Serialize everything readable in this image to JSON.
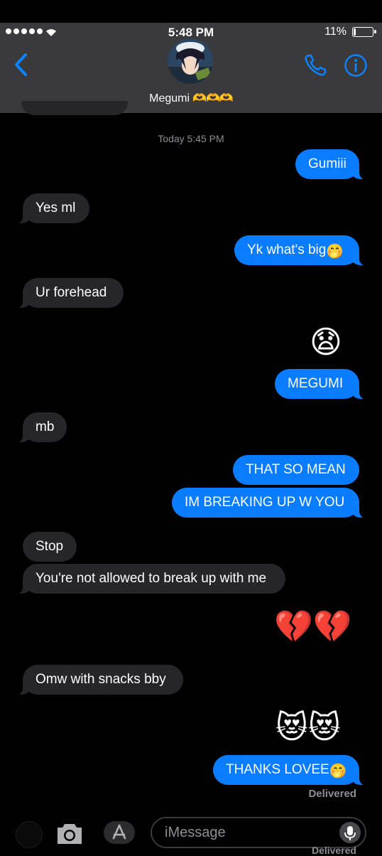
{
  "status_bar": {
    "time": "5:48 PM",
    "battery_percent": "11%",
    "battery_level": 0.11
  },
  "header": {
    "contact_name": "Megumi",
    "contact_emoji": "🫶🫶🫶",
    "back_icon": "chevron-left-icon",
    "call_icon": "phone-icon",
    "info_icon": "info-icon"
  },
  "conversation": {
    "timestamp": "Today 5:45 PM",
    "messages": {
      "m1": "Gumiii",
      "m2": "Yes ml",
      "m3": "Yk what's big",
      "m3_emoji": "🤭",
      "m4": "Ur forehead",
      "m5": "😧",
      "m6": "MEGUMI",
      "m7": "mb",
      "m8": "THAT SO MEAN",
      "m9": "IM BREAKING UP W YOU",
      "m10": "Stop",
      "m11": "You're not allowed to break up with me",
      "m12": "💔💔",
      "m13": "Omw with snacks bby",
      "m14": "😻😻",
      "m15": "THANKS LOVEE",
      "m15_emoji": "🤭"
    },
    "delivered": "Delivered",
    "delivered_cut": "Delivered"
  },
  "input_bar": {
    "placeholder": "iMessage",
    "camera_icon": "camera-icon",
    "apps_icon": "app-store-icon",
    "mic_icon": "microphone-icon"
  },
  "colors": {
    "outgoing": "#0a7cff",
    "incoming": "#262628",
    "header_bg": "#3a3a3c",
    "accent": "#0a7cff"
  }
}
